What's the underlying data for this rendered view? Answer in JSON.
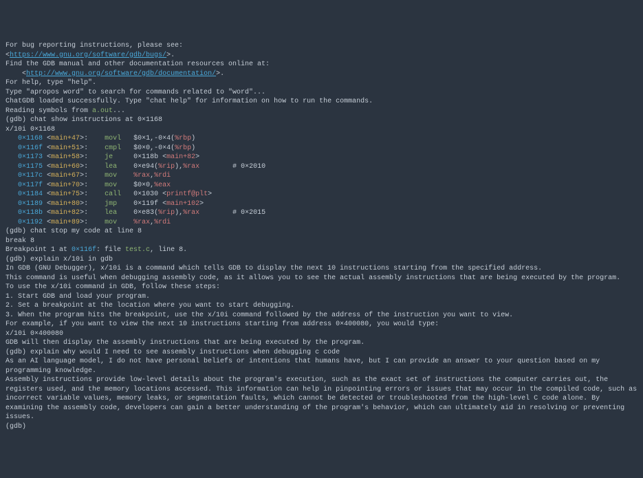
{
  "terminal": {
    "l1": "For bug reporting instructions, please see:",
    "l2a": "<",
    "l2b": "https://www.gnu.org/software/gdb/bugs/",
    "l2c": ">.",
    "l3": "Find the GDB manual and other documentation resources online at:",
    "l4a": "    <",
    "l4b": "http://www.gnu.org/software/gdb/documentation/",
    "l4c": ">.",
    "blank1": "",
    "l5": "For help, type \"help\".",
    "l6": "Type \"apropos word\" to search for commands related to \"word\"...",
    "l7": "ChatGDB loaded successfully. Type \"chat help\" for information on how to run the commands.",
    "l8a": "Reading symbols from ",
    "l8b": "a.out",
    "l8c": "...",
    "l9": "(gdb) chat show instructions at 0×1168",
    "l10": "x/10i 0×1168",
    "asm": [
      {
        "a": "   0×1168",
        "b": " <",
        "c": "main+47",
        "d": ">:",
        "op": "movl",
        "arg1": "   $0×1,-0×4(",
        "reg": "%rbp",
        "arg2": ")",
        "tail": ""
      },
      {
        "a": "   0×116f",
        "b": " <",
        "c": "main+51",
        "d": ">:",
        "op": "cmpl",
        "arg1": "   $0×0,-0×4(",
        "reg": "%rbp",
        "arg2": ")",
        "tail": ""
      },
      {
        "a": "   0×1173",
        "b": " <",
        "c": "main+58",
        "d": ">:",
        "op": "je",
        "arg1": "     0×118b <",
        "reg": "main+82",
        "arg2": ">",
        "tail": ""
      },
      {
        "a": "   0×1175",
        "b": " <",
        "c": "main+60",
        "d": ">:",
        "op": "lea",
        "arg1": "    0×e94(",
        "reg": "%rip",
        "arg2": "),",
        "reg2": "%rax",
        "tail": "        # 0×2010"
      },
      {
        "a": "   0×117c",
        "b": " <",
        "c": "main+67",
        "d": ">:",
        "op": "mov",
        "arg1": "    ",
        "reg": "%rax",
        "arg2": ",",
        "reg2": "%rdi",
        "tail": ""
      },
      {
        "a": "   0×117f",
        "b": " <",
        "c": "main+70",
        "d": ">:",
        "op": "mov",
        "arg1": "    $0×0,",
        "reg": "%eax",
        "arg2": "",
        "tail": ""
      },
      {
        "a": "   0×1184",
        "b": " <",
        "c": "main+75",
        "d": ">:",
        "op": "call",
        "arg1": "   0×1030 <",
        "reg": "printf@plt",
        "arg2": ">",
        "tail": ""
      },
      {
        "a": "   0×1189",
        "b": " <",
        "c": "main+80",
        "d": ">:",
        "op": "jmp",
        "arg1": "    0×119f <",
        "reg": "main+102",
        "arg2": ">",
        "tail": ""
      },
      {
        "a": "   0×118b",
        "b": " <",
        "c": "main+82",
        "d": ">:",
        "op": "lea",
        "arg1": "    0×e83(",
        "reg": "%rip",
        "arg2": "),",
        "reg2": "%rax",
        "tail": "        # 0×2015"
      },
      {
        "a": "   0×1192",
        "b": " <",
        "c": "main+89",
        "d": ">:",
        "op": "mov",
        "arg1": "    ",
        "reg": "%rax",
        "arg2": ",",
        "reg2": "%rdi",
        "tail": ""
      }
    ],
    "l21": "(gdb) chat stop my code at line 8",
    "l22": "break 8",
    "l23a": "Breakpoint 1 at ",
    "l23b": "0×116f",
    "l23c": ": file ",
    "l23d": "test.c",
    "l23e": ", line 8.",
    "l24": "(gdb) explain x/10i in gdb",
    "l25": "In GDB (GNU Debugger), x/10i is a command which tells GDB to display the next 10 instructions starting from the specified address.",
    "blank2": "",
    "l26": "This command is useful when debugging assembly code, as it allows you to see the actual assembly instructions that are being executed by the program.",
    "blank3": "",
    "l27": "To use the x/10i command in GDB, follow these steps:",
    "blank4": "",
    "l28": "1. Start GDB and load your program.",
    "blank5": "",
    "l29": "2. Set a breakpoint at the location where you want to start debugging.",
    "blank6": "",
    "l30": "3. When the program hits the breakpoint, use the x/10i command followed by the address of the instruction you want to view.",
    "blank7": "",
    "l31": "For example, if you want to view the next 10 instructions starting from address 0×400080, you would type:",
    "blank8": "",
    "l32": "x/10i 0×400080",
    "blank9": "",
    "l33": "GDB will then display the assembly instructions that are being executed by the program.",
    "l34": "(gdb) explain why would I need to see assembly instructions when debugging c code",
    "l35": "As an AI language model, I do not have personal beliefs or intentions that humans have, but I can provide an answer to your question based on my programming knowledge.",
    "blank10": "",
    "l36": "Assembly instructions provide low-level details about the program's execution, such as the exact set of instructions the computer carries out, the registers used, and the memory locations accessed. This information can help in pinpointing errors or issues that may occur in the compiled code, such as incorrect variable values, memory leaks, or segmentation faults, which cannot be detected or troubleshooted from the high-level C code alone. By examining the assembly code, developers can gain a better understanding of the program's behavior, which can ultimately aid in resolving or preventing issues.",
    "l37": "(gdb) "
  }
}
